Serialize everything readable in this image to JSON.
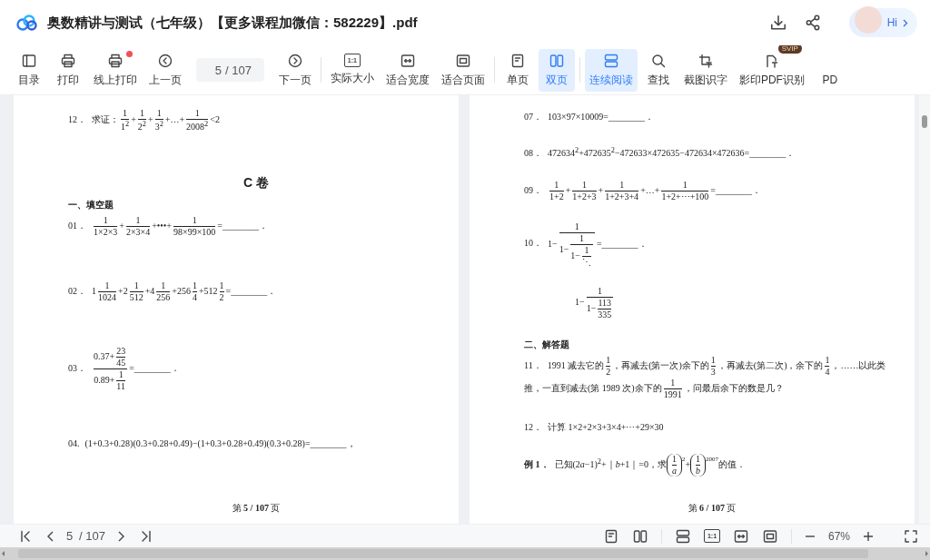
{
  "window": {
    "title": "奥数精讲与测试（七年级）【更多课程加微信：582229】.pdf",
    "greeting": "Hi"
  },
  "toolbar": {
    "groups": [
      [
        {
          "label": "目录",
          "selected": false
        },
        {
          "label": "打印",
          "selected": false
        },
        {
          "label": "线上打印",
          "selected": false,
          "notification": true
        },
        {
          "label": "上一页",
          "selected": false
        },
        {
          "kind": "page",
          "value": "5",
          "total": "/ 107"
        },
        {
          "label": "下一页",
          "selected": false
        }
      ],
      [
        {
          "label": "实际大小",
          "selected": false,
          "glyph": "1:1"
        },
        {
          "label": "适合宽度",
          "selected": false
        },
        {
          "label": "适合页面",
          "selected": false
        }
      ],
      [
        {
          "label": "单页",
          "selected": false
        },
        {
          "label": "双页",
          "selected": true
        }
      ],
      [
        {
          "label": "连续阅读",
          "selected": true
        },
        {
          "label": "查找",
          "selected": false
        },
        {
          "label": "截图识字",
          "selected": false
        },
        {
          "label": "影印PDF识别",
          "selected": false,
          "badge": "SVIP"
        },
        {
          "label": "PD",
          "selected": false
        }
      ]
    ]
  },
  "pages": [
    {
      "blocks": [
        {
          "kind": "problem",
          "number": "12．",
          "expr": [
            {
              "kind": "text",
              "text": "求证："
            },
            {
              "kind": "frac",
              "num": "1",
              "den": "1$^{2}$"
            },
            {
              "kind": "text",
              "text": "+"
            },
            {
              "kind": "frac",
              "num": "1",
              "den": "2$^{2}$"
            },
            {
              "kind": "text",
              "text": "+"
            },
            {
              "kind": "frac",
              "num": "1",
              "den": "3$^{2}$"
            },
            {
              "kind": "text",
              "text": "+…+"
            },
            {
              "kind": "frac",
              "num": "1",
              "den": "2008$^{2}$"
            },
            {
              "kind": "text",
              "text": "<2"
            }
          ]
        },
        {
          "kind": "heading",
          "text": "C 卷"
        },
        {
          "kind": "section",
          "text": "一、填空题"
        },
        {
          "kind": "problem",
          "number": "01．",
          "expr": [
            {
              "kind": "frac",
              "num": "1",
              "den": "1×2×3"
            },
            {
              "kind": "text",
              "text": "+"
            },
            {
              "kind": "frac",
              "num": "1",
              "den": "2×3×4"
            },
            {
              "kind": "text",
              "text": "+•••+"
            },
            {
              "kind": "frac",
              "num": "1",
              "den": "98×99×100"
            },
            {
              "kind": "text",
              "text": "=________．"
            }
          ]
        },
        {
          "kind": "problem",
          "number": "02．",
          "expr": [
            {
              "kind": "text",
              "text": "1"
            },
            {
              "kind": "frac",
              "num": "1",
              "den": "1024"
            },
            {
              "kind": "text",
              "text": "+2"
            },
            {
              "kind": "frac",
              "num": "1",
              "den": "512"
            },
            {
              "kind": "text",
              "text": "+4"
            },
            {
              "kind": "frac",
              "num": "1",
              "den": "256"
            },
            {
              "kind": "text",
              "text": "+256"
            },
            {
              "kind": "frac",
              "num": "1",
              "den": "4"
            },
            {
              "kind": "text",
              "text": "+512"
            },
            {
              "kind": "frac",
              "num": "1",
              "den": "2"
            },
            {
              "kind": "text",
              "text": "=________．"
            }
          ]
        },
        {
          "kind": "problem",
          "number": "03．",
          "expr": [
            {
              "kind": "frac",
              "num": [
                {
                  "kind": "text",
                  "text": "0.37+"
                },
                {
                  "kind": "frac",
                  "num": "23",
                  "den": "45"
                }
              ],
              "den": [
                {
                  "kind": "text",
                  "text": "0.89+"
                },
                {
                  "kind": "frac",
                  "num": "1",
                  "den": "11"
                }
              ]
            },
            {
              "kind": "text",
              "text": "=________．"
            }
          ]
        },
        {
          "kind": "problem",
          "number": "04.",
          "expr": [
            {
              "kind": "text",
              "text": "(1+0.3+0.28)(0.3+0.28+0.49)−(1+0.3+0.28+0.49)(0.3+0.28)=________，"
            }
          ]
        }
      ],
      "footer": "第  **5 / 107**  页"
    },
    {
      "blocks": [
        {
          "kind": "problem",
          "number": "07．",
          "expr": [
            {
              "kind": "text",
              "text": "103×97×10009=________．"
            }
          ]
        },
        {
          "kind": "problem",
          "number": "08．",
          "expr": [
            {
              "kind": "text",
              "text": "472634$^{2}$+472635$^{2}$−472633×472635−472634×472636=________．"
            }
          ]
        },
        {
          "kind": "problem",
          "number": "09．",
          "expr": [
            {
              "kind": "frac",
              "num": "1",
              "den": "1+2"
            },
            {
              "kind": "text",
              "text": "+"
            },
            {
              "kind": "frac",
              "num": "1",
              "den": "1+2+3"
            },
            {
              "kind": "text",
              "text": "+"
            },
            {
              "kind": "frac",
              "num": "1",
              "den": "1+2+3+4"
            },
            {
              "kind": "text",
              "text": "+…+"
            },
            {
              "kind": "frac",
              "num": "1",
              "den": "1+2+⋯+100"
            },
            {
              "kind": "text",
              "text": "=________．"
            }
          ]
        },
        {
          "kind": "problem",
          "number": "10．",
          "expr": [
            {
              "kind": "text",
              "text": "1−"
            },
            {
              "kind": "frac",
              "num": "1",
              "den": [
                {
                  "kind": "text",
                  "text": "1−"
                },
                {
                  "kind": "frac",
                  "num": "1",
                  "den": [
                    {
                      "kind": "text",
                      "text": "1−"
                    },
                    {
                      "kind": "frac",
                      "num": "1",
                      "den": "⋱"
                    }
                  ]
                }
              ]
            },
            {
              "kind": "text",
              "text": "=________．"
            }
          ]
        },
        {
          "kind": "continuation",
          "expr": [
            {
              "kind": "text",
              "text": "1−"
            },
            {
              "kind": "frac",
              "num": "1",
              "den": [
                {
                  "kind": "text",
                  "text": "1−"
                },
                {
                  "kind": "frac",
                  "num": "113",
                  "den": "335"
                }
              ]
            }
          ]
        },
        {
          "kind": "section",
          "text": "二、解答题"
        },
        {
          "kind": "problem",
          "number": "11．",
          "expr": [
            {
              "kind": "text",
              "text": "1991 减去它的"
            },
            {
              "kind": "frac",
              "num": "1",
              "den": "2"
            },
            {
              "kind": "text",
              "text": "，再减去(第一次)余下的"
            },
            {
              "kind": "frac",
              "num": "1",
              "den": "3"
            },
            {
              "kind": "text",
              "text": "，再减去(第二次)，余下的"
            },
            {
              "kind": "frac",
              "num": "1",
              "den": "4"
            },
            {
              "kind": "text",
              "text": "，……以此类"
            },
            {
              "kind": "text",
              "text": "推，一直到减去(第 1989 次)余下的"
            },
            {
              "kind": "frac",
              "num": "1",
              "den": "1991"
            },
            {
              "kind": "text",
              "text": "，问最后余下的数是几？"
            }
          ]
        },
        {
          "kind": "problem",
          "number": "12．",
          "expr": [
            {
              "kind": "text",
              "text": "计算 1×2+2×3+3×4+⋯+29×30"
            }
          ]
        },
        {
          "kind": "example",
          "number": "例 1．",
          "expr": [
            {
              "kind": "text",
              "text": "已知(2"
            },
            {
              "kind": "text",
              "text": "*a*−1)$^{2}$+｜*b*+1｜=0，求"
            },
            {
              "kind": "paren",
              "body": [
                {
                  "kind": "frac",
                  "num": "1",
                  "den": "*a*"
                }
              ],
              "sup": "2"
            },
            {
              "kind": "text",
              "text": "+"
            },
            {
              "kind": "paren",
              "body": [
                {
                  "kind": "frac",
                  "num": "1",
                  "den": "*b*"
                }
              ],
              "sup": "2007"
            },
            {
              "kind": "text",
              "text": "的值．"
            }
          ]
        }
      ],
      "footer": "第  **6 / 107**  页"
    }
  ],
  "bottom_bar": {
    "page": "5",
    "total": "/ 107",
    "glyph": "1:1",
    "zoom": "67%"
  }
}
